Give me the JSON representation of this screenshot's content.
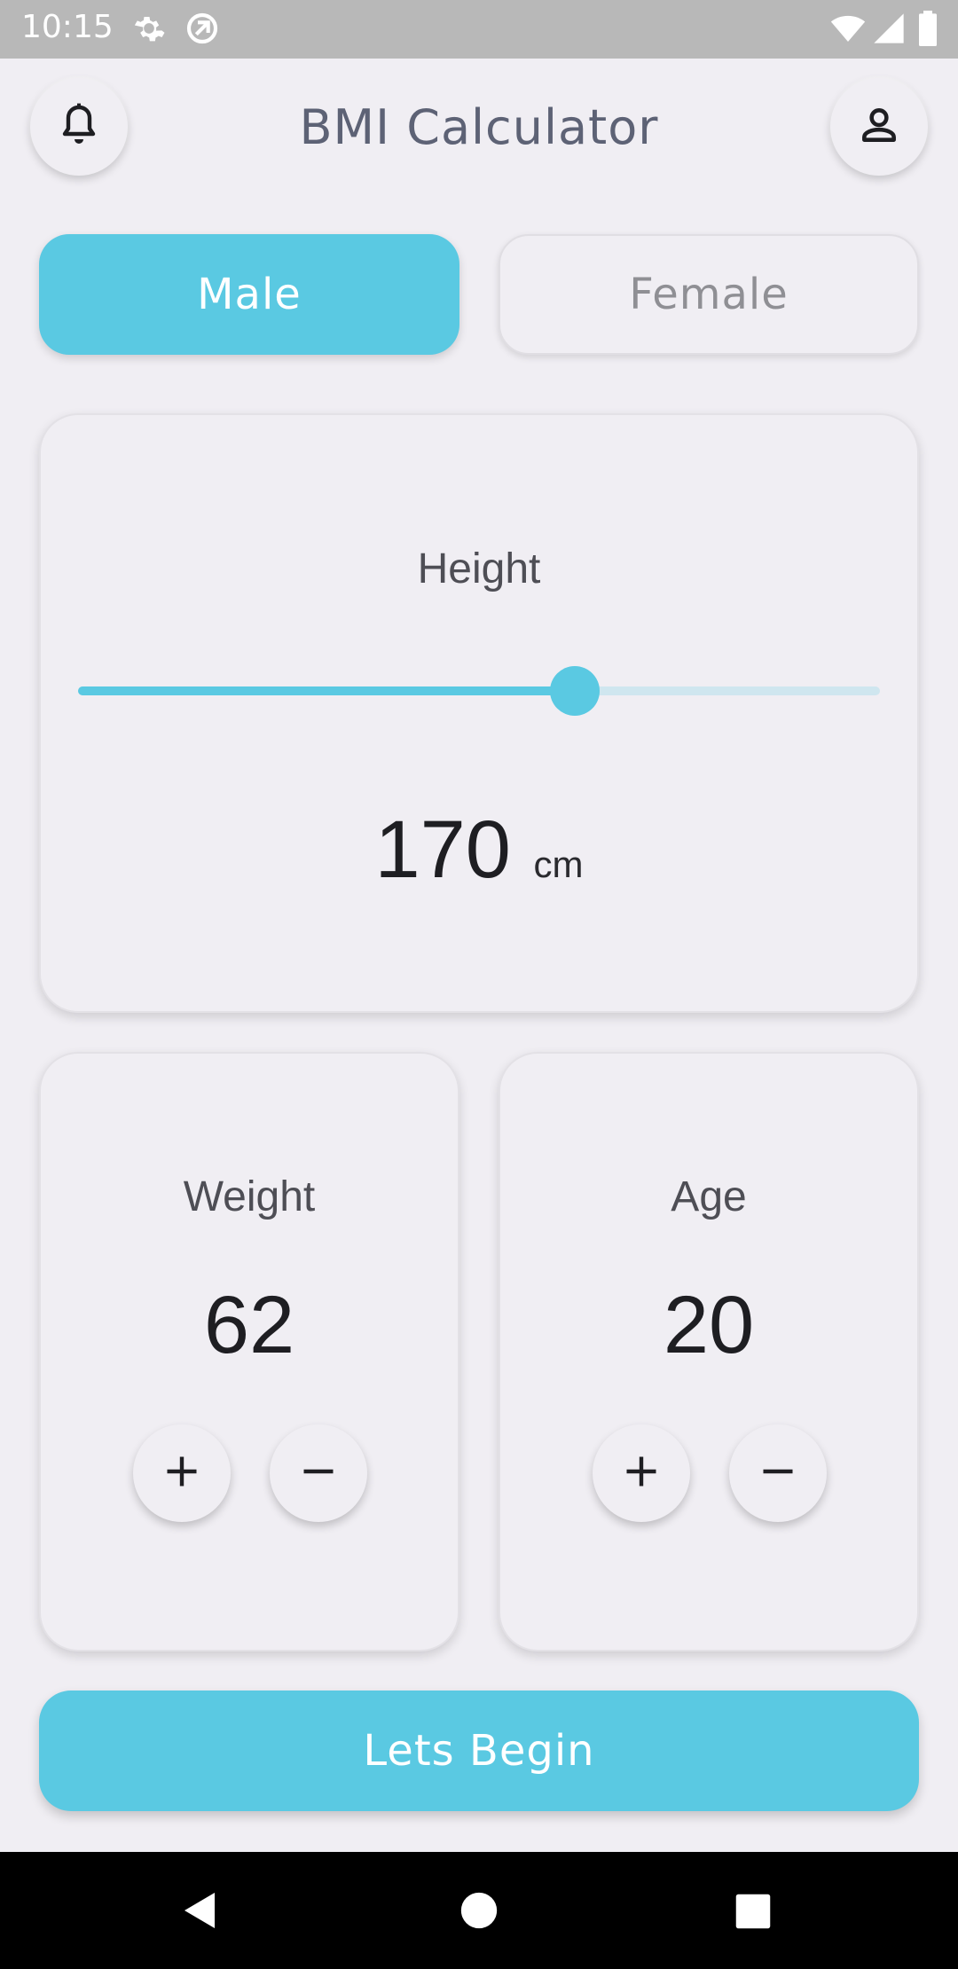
{
  "status_bar": {
    "time": "10:15",
    "icons": [
      "settings-icon",
      "sync-icon",
      "wifi-icon",
      "signal-icon",
      "battery-icon"
    ]
  },
  "app_bar": {
    "title": "BMI Calculator",
    "left_icon": "bell-icon",
    "right_icon": "person-icon"
  },
  "gender": {
    "male_label": "Male",
    "female_label": "Female",
    "selected": "Male"
  },
  "height": {
    "label": "Height",
    "value": "170",
    "unit": "cm",
    "slider_fraction": 0.62
  },
  "weight": {
    "label": "Weight",
    "value": "62",
    "plus": "+",
    "minus": "−"
  },
  "age": {
    "label": "Age",
    "value": "20",
    "plus": "+",
    "minus": "−"
  },
  "action": {
    "begin_label": "Lets Begin"
  },
  "colors": {
    "accent": "#5ac9e2",
    "background": "#f0eef3",
    "title": "#5d6275"
  },
  "nav_bar": {
    "icons": [
      "back-icon",
      "home-icon",
      "recents-icon"
    ]
  }
}
